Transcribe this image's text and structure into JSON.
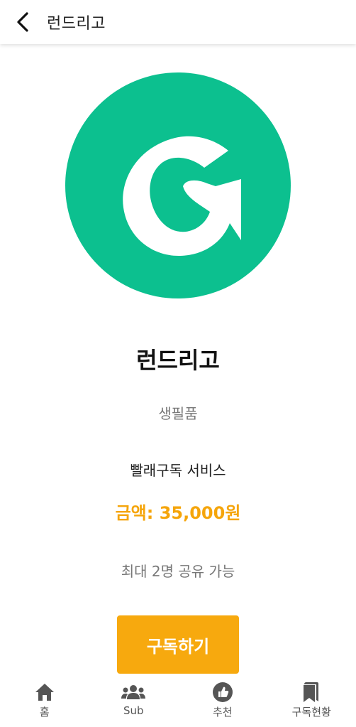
{
  "header": {
    "title": "런드리고"
  },
  "logo": {
    "background_color": "#0cc08f",
    "letter": "G"
  },
  "service": {
    "name": "런드리고",
    "category": "생필품",
    "description": "빨래구독 서비스",
    "price": "금액: 35,000원",
    "share_info": "최대 2명 공유 가능"
  },
  "actions": {
    "subscribe_label": "구독하기"
  },
  "colors": {
    "accent": "#f7a90e",
    "price_text": "#f5a50b",
    "brand_green": "#0cc08f"
  },
  "bottom_nav": {
    "items": [
      {
        "label": "홈",
        "icon": "home-icon"
      },
      {
        "label": "Sub",
        "icon": "users-icon"
      },
      {
        "label": "추천",
        "icon": "thumbs-up-icon"
      },
      {
        "label": "구독현황",
        "icon": "bookmark-icon"
      }
    ]
  }
}
